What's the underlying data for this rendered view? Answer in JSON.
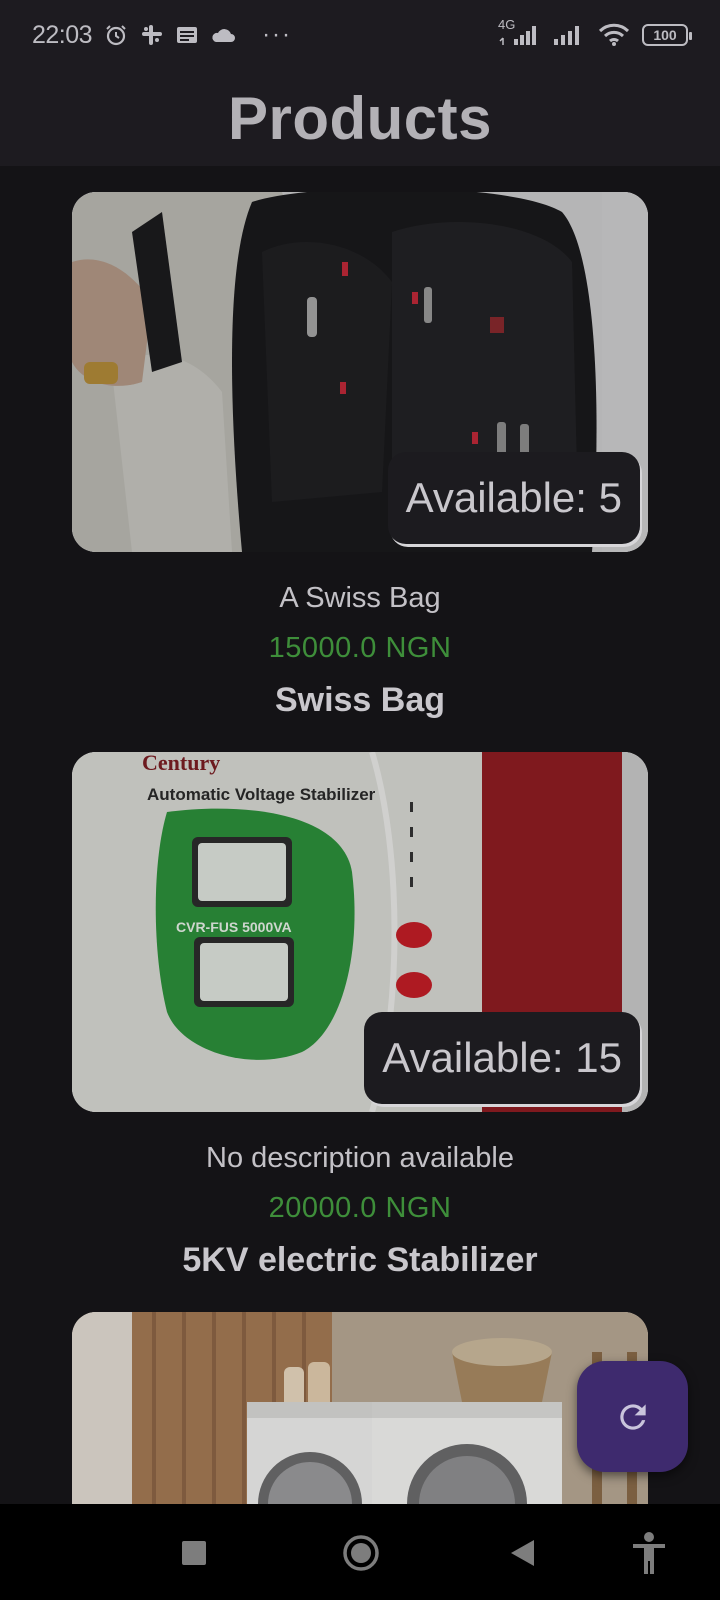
{
  "status_bar": {
    "time": "22:03",
    "network": "4G",
    "battery": "100",
    "more": "···",
    "icons": [
      "alarm-icon",
      "slack-icon",
      "news-icon",
      "cloud-icon",
      "signal-icon",
      "signal-icon",
      "wifi-icon",
      "battery-icon"
    ]
  },
  "app_bar": {
    "title": "Products"
  },
  "products": [
    {
      "availability": "Available: 5",
      "description": "A Swiss Bag",
      "price": "15000.0 NGN",
      "name": "Swiss Bag",
      "image": "backpack-photo"
    },
    {
      "availability": "Available: 15",
      "description": "No description available",
      "price": "20000.0 NGN",
      "name": "5KV electric Stabilizer",
      "image": "voltage-stabilizer-photo",
      "image_text": {
        "brand": "Century",
        "caption": "Automatic Voltage Stabilizer",
        "model": "CVR-FUS 5000VA"
      }
    },
    {
      "image": "washing-machines-photo"
    }
  ],
  "fab": {
    "icon": "refresh-icon"
  },
  "nav_bar": {
    "icons": [
      "recents-icon",
      "home-icon",
      "back-icon",
      "accessibility-icon"
    ]
  },
  "colors": {
    "background": "#141316",
    "app_bar": "#1d1b20",
    "price": "#3e8e3a",
    "fab": "#3e2a6e"
  }
}
